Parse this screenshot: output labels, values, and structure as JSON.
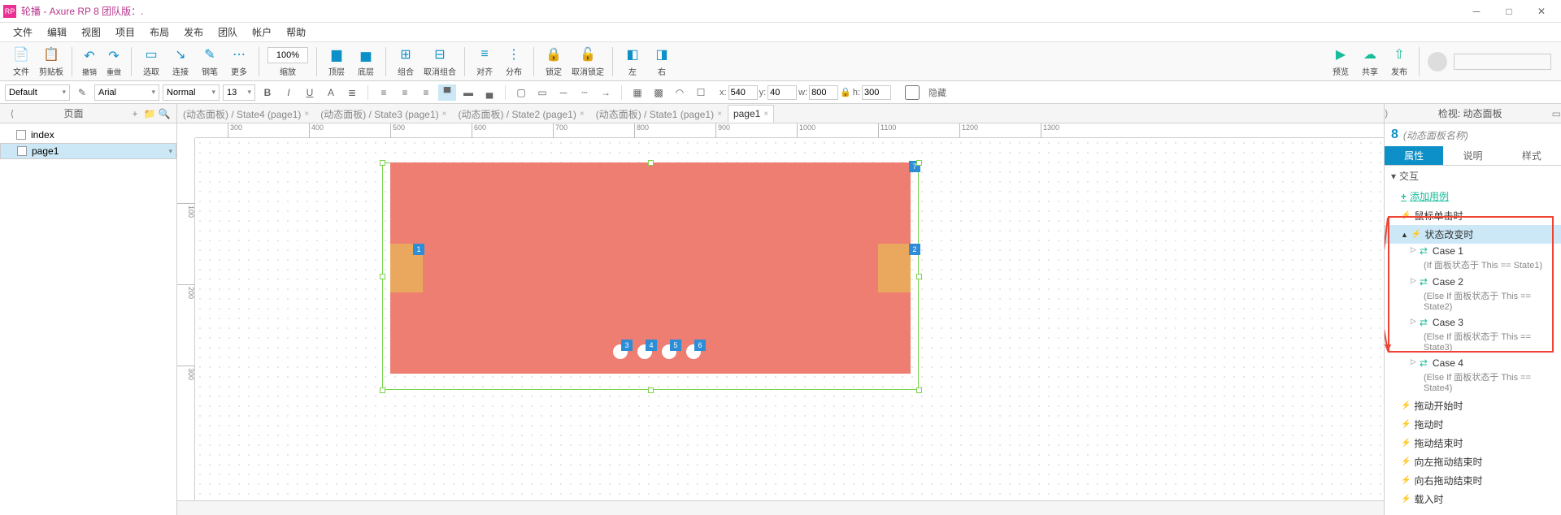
{
  "title": "轮播 - Axure RP 8 团队版：.",
  "menus": [
    "文件",
    "编辑",
    "视图",
    "项目",
    "布局",
    "发布",
    "团队",
    "帐户",
    "帮助"
  ],
  "toolbar": {
    "file": "文件",
    "clipboard": "剪贴板",
    "undo": "撤销",
    "redo": "重做",
    "select": "选取",
    "connect": "连接",
    "pen": "钢笔",
    "more": "更多",
    "zoom": "100%",
    "zoomlbl": "缩放",
    "front": "顶层",
    "back": "底层",
    "group": "组合",
    "ungroup": "取消组合",
    "align": "对齐",
    "distribute": "分布",
    "lock": "锁定",
    "unlock": "取消锁定",
    "left": "左",
    "right": "右",
    "preview": "预览",
    "share": "共享",
    "publish": "发布"
  },
  "format": {
    "style": "Default",
    "font": "Arial",
    "weight": "Normal",
    "size": "13",
    "x_lbl": "x:",
    "x": "540",
    "y_lbl": "y:",
    "y": "40",
    "w_lbl": "w:",
    "w": "800",
    "h_lbl": "h:",
    "h": "300",
    "hidden": "隐藏"
  },
  "pages": {
    "title": "页面",
    "items": [
      "index",
      "page1"
    ]
  },
  "tabs": [
    "(动态面板) / State4 (page1)",
    "(动态面板) / State3 (page1)",
    "(动态面板) / State2 (page1)",
    "(动态面板) / State1 (page1)",
    "page1"
  ],
  "ruler_h": [
    "300",
    "400",
    "500",
    "600",
    "700",
    "800",
    "900",
    "1000",
    "1100",
    "1200",
    "1300"
  ],
  "ruler_v": [
    "100",
    "200",
    "300"
  ],
  "badges": [
    "1",
    "2",
    "3",
    "4",
    "5",
    "6",
    "7"
  ],
  "inspector": {
    "title": "检视: 动态面板",
    "fn": "8",
    "name": "(动态面板名称)",
    "tabs": [
      "属性",
      "说明",
      "样式"
    ],
    "section": "交互",
    "addcase": "添加用例",
    "events": {
      "click": "鼠标单击时",
      "statechange": "状态改变时",
      "dragstart": "拖动开始时",
      "drag": "拖动时",
      "dragend": "拖动结束时",
      "swipeleft": "向左拖动结束时",
      "swiperight": "向右拖动结束时",
      "load": "载入时"
    },
    "cases": [
      {
        "name": "Case 1",
        "cond": "(If 面板状态于 This == State1)"
      },
      {
        "name": "Case 2",
        "cond": "(Else If 面板状态于 This == State2)"
      },
      {
        "name": "Case 3",
        "cond": "(Else If 面板状态于 This == State3)"
      },
      {
        "name": "Case 4",
        "cond": "(Else If 面板状态于 This == State4)"
      }
    ]
  }
}
